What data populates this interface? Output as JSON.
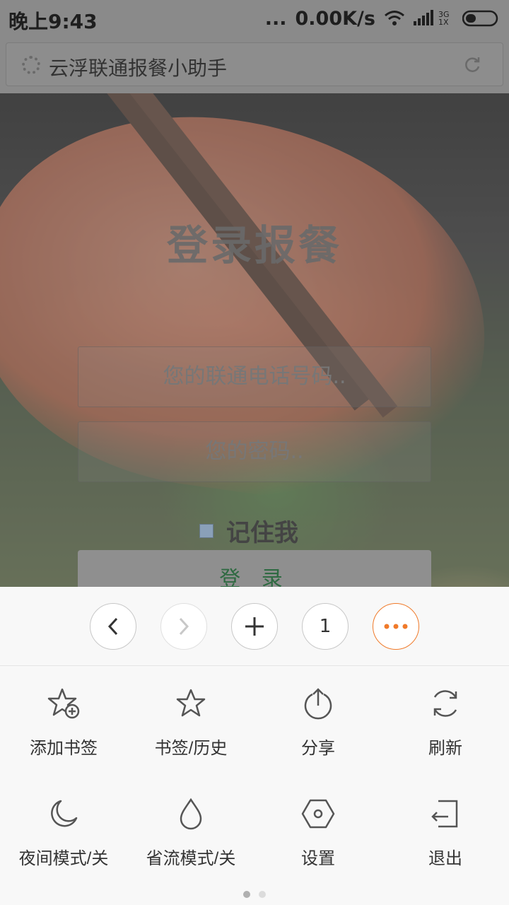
{
  "status_bar": {
    "time": "晚上9:43",
    "dots": "...",
    "speed": "0.00K/s",
    "network": "3G 1X"
  },
  "address_bar": {
    "title": "云浮联通报餐小助手"
  },
  "login": {
    "title": "登录报餐",
    "phone_placeholder": "您的联通电话号码..",
    "password_placeholder": "您的密码..",
    "remember_label": "记住我",
    "login_button": "登 录"
  },
  "browser_nav": {
    "tab_count": "1"
  },
  "menu": {
    "items": [
      {
        "label": "添加书签",
        "icon": "star-plus-icon"
      },
      {
        "label": "书签/历史",
        "icon": "star-icon"
      },
      {
        "label": "分享",
        "icon": "share-icon"
      },
      {
        "label": "刷新",
        "icon": "refresh-icon"
      },
      {
        "label": "夜间模式/关",
        "icon": "moon-icon"
      },
      {
        "label": "省流模式/关",
        "icon": "drop-icon"
      },
      {
        "label": "设置",
        "icon": "hexagon-settings-icon"
      },
      {
        "label": "退出",
        "icon": "exit-icon"
      }
    ],
    "page_count": 2,
    "active_page": 1
  },
  "colors": {
    "accent": "#f07a2a",
    "menu_bg": "#f8f8f8",
    "icon": "#555555"
  }
}
